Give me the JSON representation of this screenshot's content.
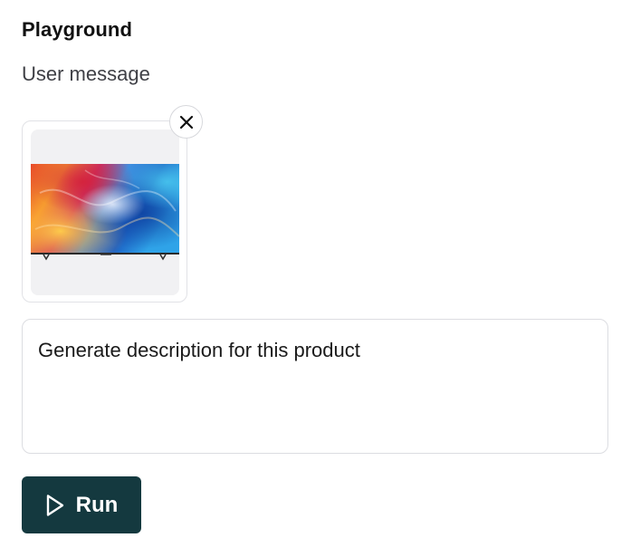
{
  "header": {
    "title": "Playground"
  },
  "message_section": {
    "label": "User message",
    "attachment": {
      "kind": "image",
      "depicts": "television-product-photo",
      "remove_icon": "close-icon"
    },
    "input": {
      "value": "Generate description for this product"
    }
  },
  "actions": {
    "run_label": "Run",
    "run_icon": "play-icon"
  },
  "colors": {
    "run_button_bg": "#14393f",
    "run_button_text": "#ffffff",
    "border": "#dcdde1",
    "thumb_bg": "#f1f1f3",
    "label_text": "#3f4046"
  }
}
